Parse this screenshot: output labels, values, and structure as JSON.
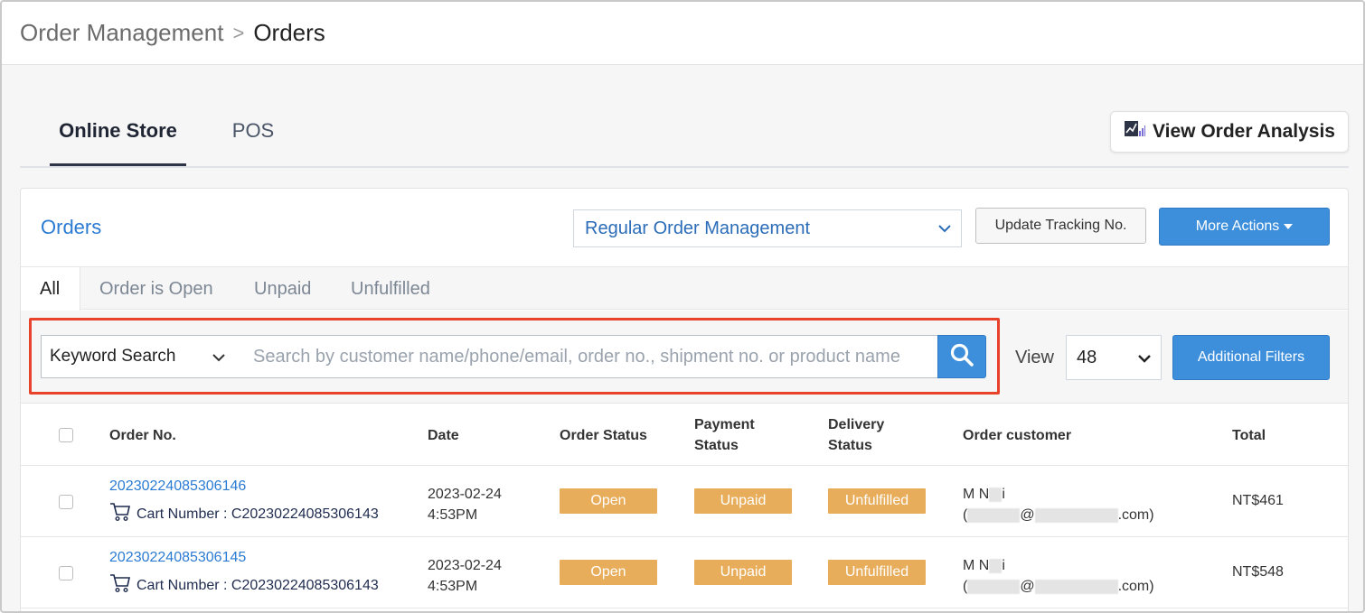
{
  "breadcrumb": {
    "parent": "Order Management",
    "separator": ">",
    "current": "Orders"
  },
  "main_tabs": [
    {
      "label": "Online Store",
      "active": true
    },
    {
      "label": "POS",
      "active": false
    }
  ],
  "analysis_button": {
    "label": "View Order Analysis",
    "icon": "chart-icon"
  },
  "panel": {
    "title": "Orders",
    "management_select": "Regular Order Management",
    "update_tracking_label": "Update Tracking No.",
    "more_actions_label": "More Actions"
  },
  "sub_tabs": [
    {
      "label": "All",
      "active": true
    },
    {
      "label": "Order is Open",
      "active": false
    },
    {
      "label": "Unpaid",
      "active": false
    },
    {
      "label": "Unfulfilled",
      "active": false
    }
  ],
  "search": {
    "type_select": "Keyword Search",
    "placeholder": "Search by customer name/phone/email, order no., shipment no. or product name",
    "value": ""
  },
  "view": {
    "label": "View",
    "selected": "48"
  },
  "filters_label": "Additional Filters",
  "table": {
    "headers": {
      "order_no": "Order No.",
      "date": "Date",
      "order_status": "Order Status",
      "payment_status_1": "Payment",
      "payment_status_2": "Status",
      "delivery_status_1": "Delivery",
      "delivery_status_2": "Status",
      "customer": "Order customer",
      "total": "Total"
    },
    "rows": [
      {
        "order_no": "20230224085306146",
        "cart_label": "Cart Number : C20230224085306143",
        "date": "2023-02-24",
        "time": "4:53PM",
        "order_status": "Open",
        "payment_status": "Unpaid",
        "delivery_status": "Unfulfilled",
        "customer_name_a": "M N",
        "customer_name_b": "i",
        "email_open": "(",
        "email_at": "@",
        "email_end": ".com)",
        "total": "NT$461"
      },
      {
        "order_no": "20230224085306145",
        "cart_label": "Cart Number : C20230224085306143",
        "date": "2023-02-24",
        "time": "4:53PM",
        "order_status": "Open",
        "payment_status": "Unpaid",
        "delivery_status": "Unfulfilled",
        "customer_name_a": "M N",
        "customer_name_b": "i",
        "email_open": "(",
        "email_at": "@",
        "email_end": ".com)",
        "total": "NT$548"
      }
    ]
  },
  "colors": {
    "accent_blue": "#3d8fdc",
    "link_blue": "#2b7bd3",
    "badge_orange": "#e8ad5a",
    "highlight_red": "#e8432a"
  }
}
